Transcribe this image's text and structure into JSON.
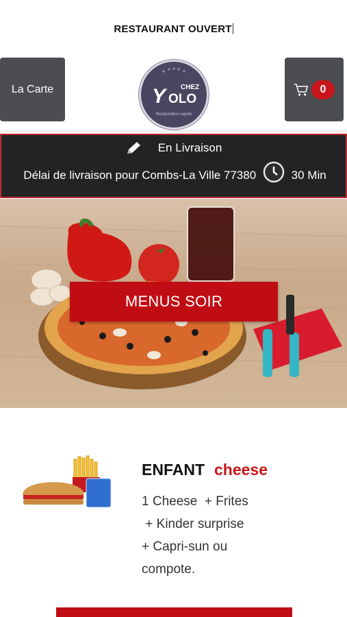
{
  "status": {
    "text": "RESTAURANT OUVERT"
  },
  "nav": {
    "menu_label": "La Carte",
    "cart_count": "0"
  },
  "logo": {
    "word_chez": "CHEZ",
    "word_yolo": "OLO",
    "tagline": "Restauration rapide"
  },
  "delivery": {
    "mode": "En Livraison",
    "line": "Délai de livraison pour Combs-La Ville 77380",
    "time": "30 Min"
  },
  "hero": {
    "cta_label": "MENUS SOIR"
  },
  "product": {
    "title_main": "ENFANT",
    "title_accent": "cheese",
    "description_lines": [
      "1 Cheese  + Frites",
      " + Kinder surprise",
      "+ Capri-sun ou",
      "compote."
    ]
  },
  "colors": {
    "accent": "#c8151b",
    "nav_bg": "#4b4d51",
    "delivery_bg": "#232326"
  },
  "icons": [
    "cart-icon",
    "pencil-icon",
    "clock-icon"
  ]
}
